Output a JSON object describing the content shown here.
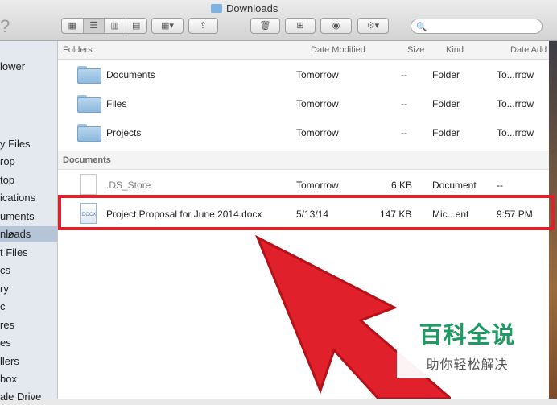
{
  "window": {
    "title": "Downloads"
  },
  "toolbar": {
    "help_label": "?",
    "view_buttons": [
      "icon-view-icon",
      "list-view-icon",
      "column-view-icon",
      "coverflow-view-icon"
    ],
    "arrange_icon": "arrange-grid-icon",
    "share_icon": "share-icon",
    "trash_icon": "trash-icon",
    "new_folder_icon": "new-folder-icon",
    "quicklook_icon": "eye-icon",
    "action_icon": "gear-icon",
    "search": {
      "placeholder": ""
    }
  },
  "sidebar": {
    "items": [
      {
        "label": "lower"
      },
      {
        "label": "y Files"
      },
      {
        "label": "rop"
      },
      {
        "label": "top"
      },
      {
        "label": "ications"
      },
      {
        "label": "uments"
      },
      {
        "label": "nloads",
        "selected": true
      },
      {
        "label": "t Files"
      },
      {
        "label": "cs"
      },
      {
        "label": "ry"
      },
      {
        "label": "c"
      },
      {
        "label": "res"
      },
      {
        "label": "es"
      },
      {
        "label": "llers"
      },
      {
        "label": "box"
      },
      {
        "label": "ale Drive"
      }
    ]
  },
  "columns": {
    "folders_header": "Folders",
    "date_modified": "Date Modified",
    "size": "Size",
    "kind": "Kind",
    "date_added": "Date Add"
  },
  "folders": [
    {
      "name": "Documents",
      "date": "Tomorrow",
      "size": "--",
      "kind": "Folder",
      "added": "To...rrow"
    },
    {
      "name": "Files",
      "date": "Tomorrow",
      "size": "--",
      "kind": "Folder",
      "added": "To...rrow"
    },
    {
      "name": "Projects",
      "date": "Tomorrow",
      "size": "--",
      "kind": "Folder",
      "added": "To...rrow"
    }
  ],
  "documents_header": "Documents",
  "documents": [
    {
      "name": ".DS_Store",
      "date": "Tomorrow",
      "size": "6 KB",
      "kind": "Document",
      "added": "--"
    },
    {
      "name": "Project Proposal for June 2014.docx",
      "date": "5/13/14",
      "size": "147 KB",
      "kind": "Mic...ent",
      "added": "9:57 PM",
      "icon_label": "DOCX"
    }
  ],
  "watermark": {
    "main": "百科全说",
    "sub": "助你轻松解决"
  },
  "colors": {
    "highlight": "#e0202a",
    "arrow": "#e0202a",
    "selection": "#b6c4d7",
    "watermark": "#1f9a62"
  }
}
